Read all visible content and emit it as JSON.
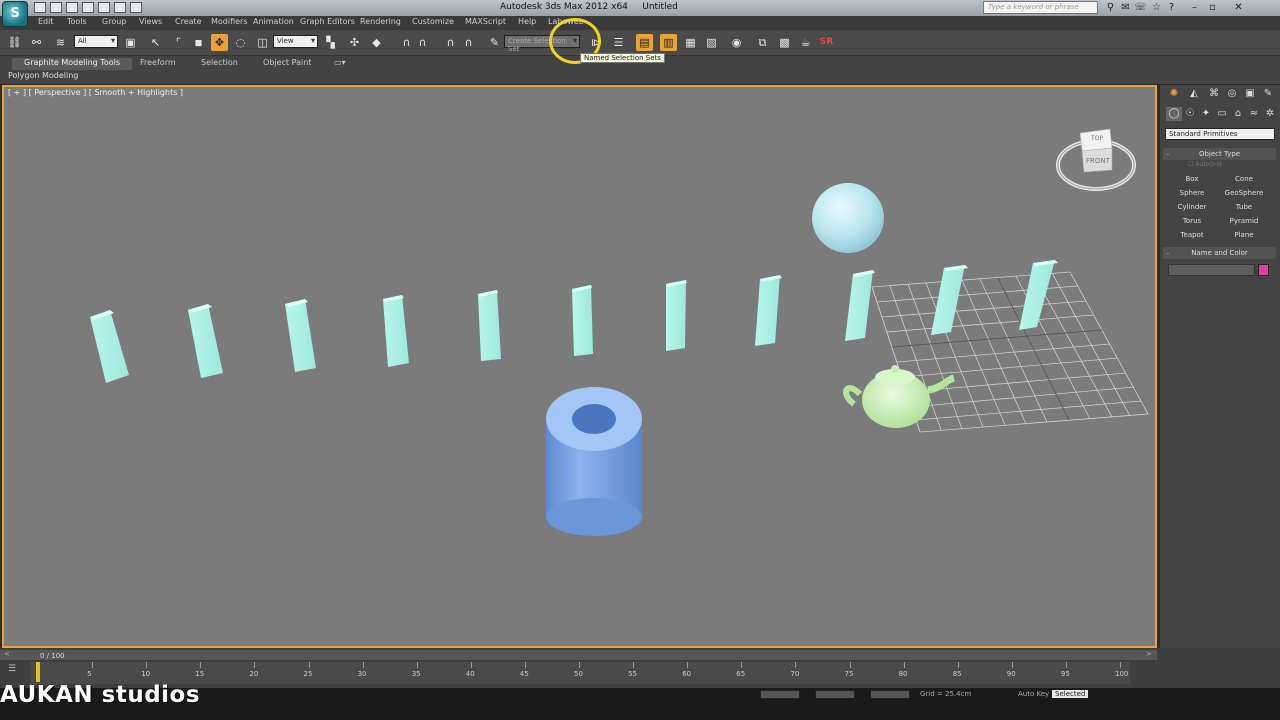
{
  "app": {
    "logo_letter": "S",
    "title": "Autodesk 3ds Max 2012 x64",
    "document": "Untitled",
    "search_placeholder": "Type a keyword or phrase"
  },
  "menu": {
    "items": [
      "Edit",
      "Tools",
      "Group",
      "Views",
      "Create",
      "Modifiers",
      "Animation",
      "Graph Editors",
      "Rendering",
      "Customize",
      "MAXScript",
      "Help",
      "Laboweb"
    ]
  },
  "toolbar": {
    "selection_filter": "All",
    "ref_coord": "View",
    "named_selection": "Create Selection Set",
    "tooltip": "Named Selection Sets",
    "sr_label": "SR"
  },
  "ribbon": {
    "tabs": [
      "Graphite Modeling Tools",
      "Freeform",
      "Selection",
      "Object Paint"
    ],
    "panel_label": "Polygon Modeling"
  },
  "viewport": {
    "label": "[ + ] [ Perspective ] [ Smooth + Highlights ]",
    "viewcube_top": "TOP",
    "viewcube_front": "FRONT",
    "colors": {
      "boxes": "#a8f0e4",
      "sphere": "#c4eaf2",
      "tube": "#78a4e4",
      "teapot": "#c8f0b8",
      "grid": "#cfcfcf"
    }
  },
  "command_panel": {
    "dropdown": "Standard Primitives",
    "object_type_title": "Object Type",
    "autogrid_label": "AutoGrid",
    "primitives": [
      "Box",
      "Cone",
      "Sphere",
      "GeoSphere",
      "Cylinder",
      "Tube",
      "Torus",
      "Pyramid",
      "Teapot",
      "Plane"
    ],
    "name_color_title": "Name and Color",
    "object_color": "#ec3aa2"
  },
  "timeline": {
    "frame_counter": "0 / 100",
    "ticks": [
      "5",
      "10",
      "15",
      "20",
      "25",
      "30",
      "35",
      "40",
      "45",
      "50",
      "55",
      "60",
      "65",
      "70",
      "75",
      "80",
      "85",
      "90",
      "95",
      "100"
    ]
  },
  "status": {
    "watermark": "AUKAN studios",
    "grid_label": "Grid = 25.4cm",
    "auto_key": "Auto Key",
    "selected": "Selected"
  }
}
